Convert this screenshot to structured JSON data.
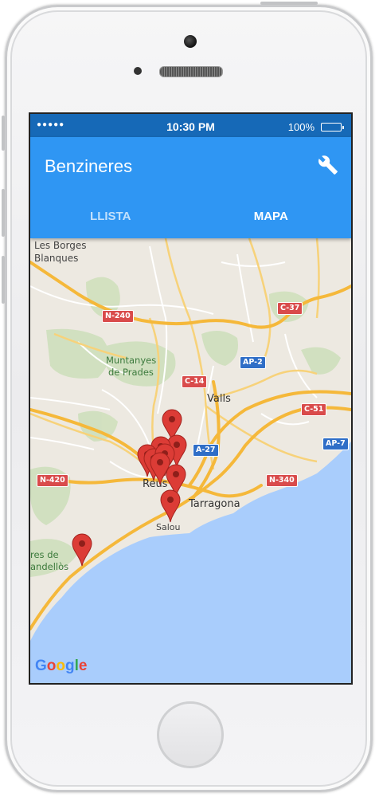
{
  "status_bar": {
    "signal": "●●●●●",
    "time": "10:30 PM",
    "battery": "100%"
  },
  "app_bar": {
    "title": "Benzineres",
    "settings_icon": "wrench-icon"
  },
  "tabs": [
    {
      "label": "LLISTA",
      "active": false
    },
    {
      "label": "MAPA",
      "active": true
    }
  ],
  "map": {
    "labels": {
      "les_borges": "Les Borges",
      "blanques": "Blanques",
      "muntanyes": "Muntanyes",
      "de_prades": "de Prades",
      "valls": "Valls",
      "reus": "Reus",
      "tarragona": "Tarragona",
      "salou": "Salou",
      "res_de": "res de",
      "andellos": "andellòs"
    },
    "roads": {
      "n240": "N-240",
      "c37": "C-37",
      "ap2": "AP-2",
      "c14": "C-14",
      "c51": "C-51",
      "a27": "A-27",
      "ap7": "AP-7",
      "n420": "N-420",
      "n340": "N-340"
    },
    "attribution": {
      "G": "G",
      "o1": "o",
      "o2": "o",
      "g": "g",
      "l": "l",
      "e": "e"
    },
    "marker_count": 10,
    "colors": {
      "sea": "#a9cdfc",
      "land": "#ede9e1",
      "highway": "#f5b83a",
      "marker": "#dc3c36"
    }
  }
}
